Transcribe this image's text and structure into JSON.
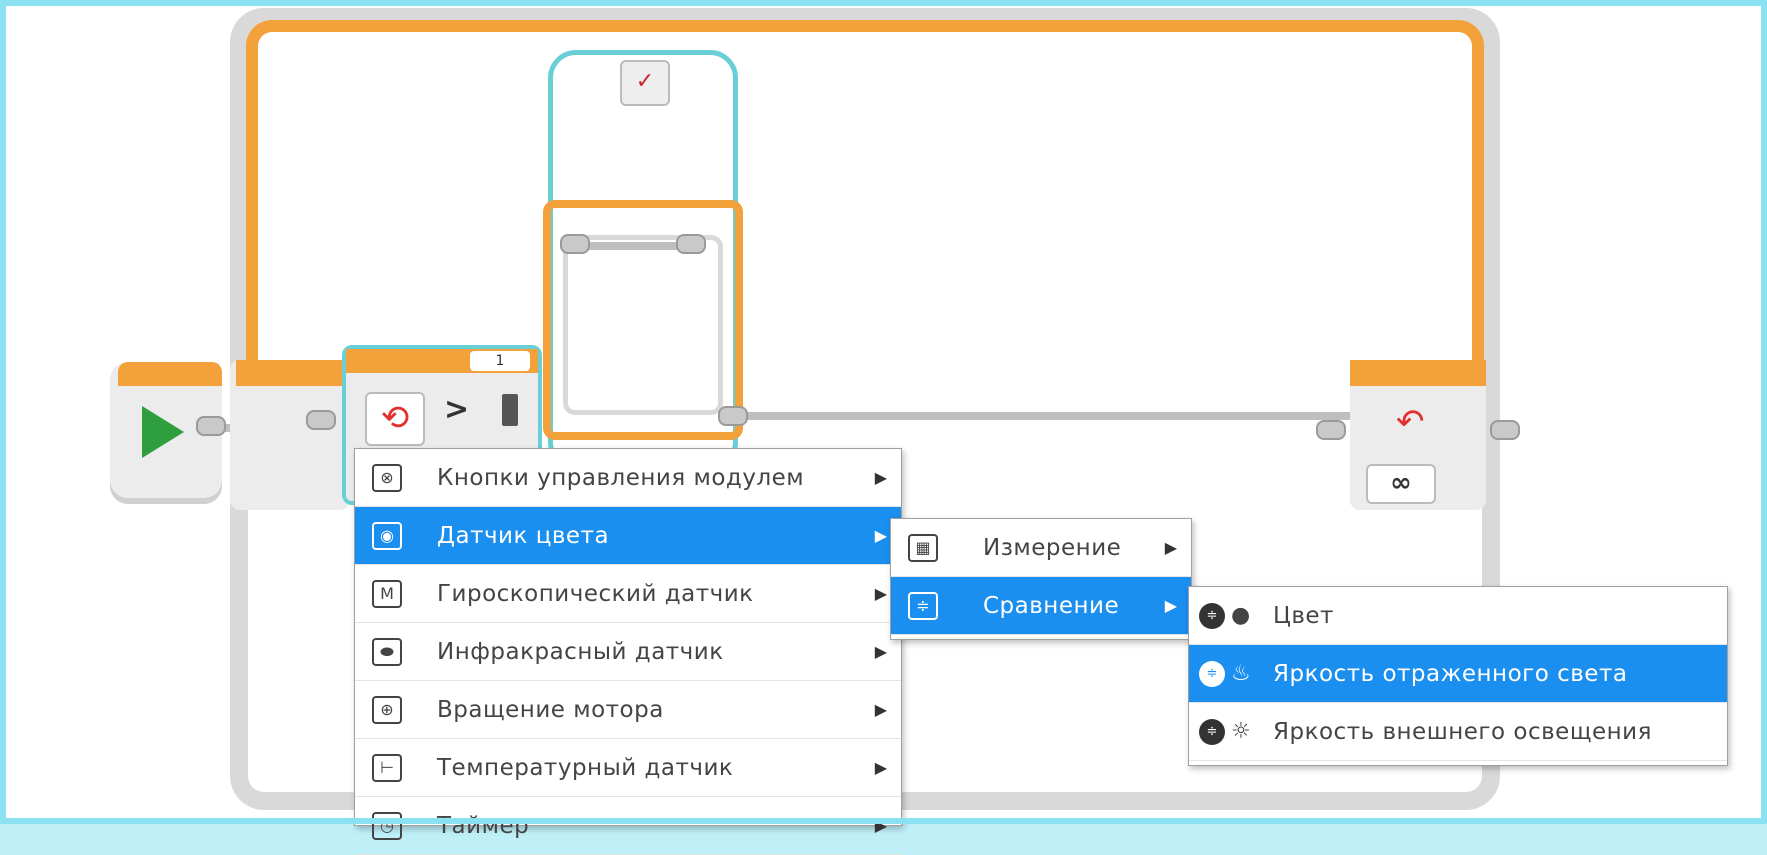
{
  "switch_block": {
    "case_number": "1"
  },
  "loop_end": {
    "count_label": "∞"
  },
  "case_tab_icon": "✓",
  "icons": {
    "start": "play-icon",
    "loop_end": "loop-arrow-icon",
    "switch_mode": "switch-mode-icon"
  },
  "menu_main": {
    "items": [
      {
        "label": "Кнопки управления модулем",
        "icon": "brick-buttons-icon",
        "glyph": "⊗"
      },
      {
        "label": "Датчик цвета",
        "icon": "color-sensor-icon",
        "glyph": "◉"
      },
      {
        "label": "Гироскопический датчик",
        "icon": "gyro-sensor-icon",
        "glyph": "M"
      },
      {
        "label": "Инфракрасный датчик",
        "icon": "infrared-sensor-icon",
        "glyph": "⬬"
      },
      {
        "label": "Вращение мотора",
        "icon": "motor-rotation-icon",
        "glyph": "⊕"
      },
      {
        "label": "Температурный датчик",
        "icon": "temperature-sensor-icon",
        "glyph": "⊢"
      },
      {
        "label": "Таймер",
        "icon": "timer-icon",
        "glyph": "◷"
      }
    ]
  },
  "menu_color": {
    "items": [
      {
        "label": "Измерение",
        "icon": "measure-icon",
        "glyph": "▦"
      },
      {
        "label": "Сравнение",
        "icon": "compare-icon",
        "glyph": "≑"
      }
    ]
  },
  "menu_compare": {
    "items": [
      {
        "label": "Цвет",
        "icon": "color-icon",
        "glyph": "●"
      },
      {
        "label": "Яркость отраженного света",
        "icon": "reflected-light-icon",
        "glyph": "♨"
      },
      {
        "label": "Яркость внешнего освещения",
        "icon": "ambient-light-icon",
        "glyph": "☼"
      }
    ]
  },
  "colors": {
    "orange": "#f2a13b",
    "teal": "#69cfd6",
    "menu_highlight": "#1a8ff0",
    "start_green": "#2f9e3f",
    "loop_red": "#e03030"
  }
}
